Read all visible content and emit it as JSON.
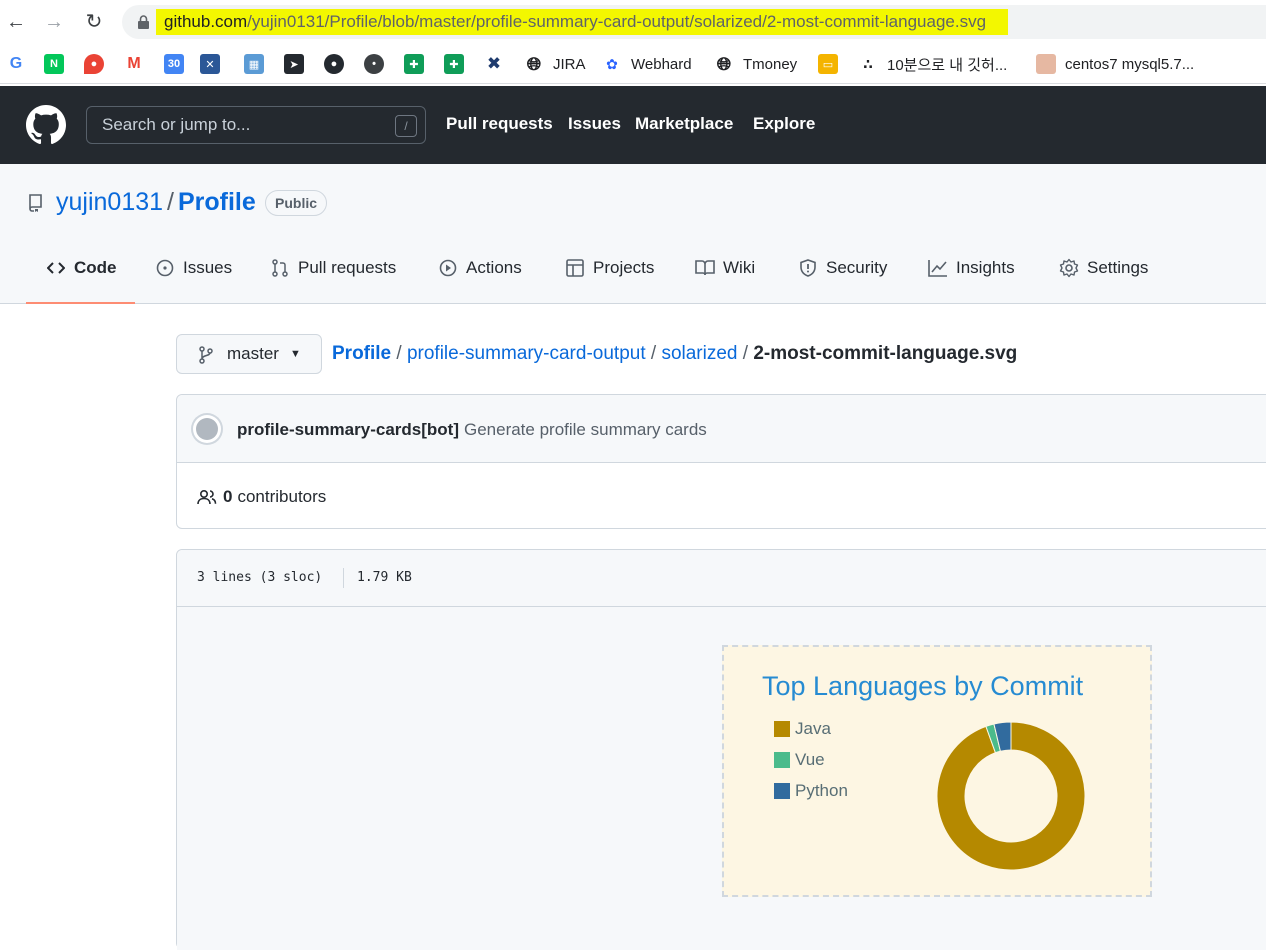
{
  "browser": {
    "url_host": "github.com",
    "url_path": "/yujin0131/Profile/blob/master/profile-summary-card-output/solarized/2-most-commit-language.svg",
    "bookmarks": [
      {
        "label": "",
        "icon": "google-icon"
      },
      {
        "label": "",
        "icon": "naver-icon"
      },
      {
        "label": "",
        "icon": "maps-icon"
      },
      {
        "label": "",
        "icon": "gmail-icon"
      },
      {
        "label": "",
        "icon": "calendar-icon"
      },
      {
        "label": "",
        "icon": "app-icon"
      },
      {
        "label": "",
        "icon": "map-book-icon"
      },
      {
        "label": "",
        "icon": "bird-icon"
      },
      {
        "label": "",
        "icon": "github-icon"
      },
      {
        "label": "",
        "icon": "blob-icon"
      },
      {
        "label": "",
        "icon": "sheets-icon"
      },
      {
        "label": "",
        "icon": "sheets-icon"
      },
      {
        "label": "",
        "icon": "tool-icon"
      },
      {
        "label": "JIRA",
        "icon": "globe-icon"
      },
      {
        "label": "Webhard",
        "icon": "feather-icon"
      },
      {
        "label": "Tmoney",
        "icon": "globe-icon"
      },
      {
        "label": "",
        "icon": "slides-icon"
      },
      {
        "label": "10분으로 내 깃허...",
        "icon": "dots-icon"
      },
      {
        "label": "centos7 mysql5.7...",
        "icon": "face-icon"
      }
    ]
  },
  "header": {
    "search_placeholder": "Search or jump to...",
    "slash_key": "/",
    "nav": [
      "Pull requests",
      "Issues",
      "Marketplace",
      "Explore"
    ]
  },
  "repo": {
    "owner": "yujin0131",
    "separator": "/",
    "name": "Profile",
    "visibility": "Public",
    "tabs": [
      {
        "label": "Code",
        "icon": "code-icon"
      },
      {
        "label": "Issues",
        "icon": "issue-icon"
      },
      {
        "label": "Pull requests",
        "icon": "pull-request-icon"
      },
      {
        "label": "Actions",
        "icon": "play-icon"
      },
      {
        "label": "Projects",
        "icon": "table-icon"
      },
      {
        "label": "Wiki",
        "icon": "book-icon"
      },
      {
        "label": "Security",
        "icon": "shield-icon"
      },
      {
        "label": "Insights",
        "icon": "graph-icon"
      },
      {
        "label": "Settings",
        "icon": "gear-icon"
      }
    ]
  },
  "file": {
    "branch": "master",
    "crumbs": [
      "Profile",
      "profile-summary-card-output",
      "solarized"
    ],
    "crumb_sep": "/",
    "filename": "2-most-commit-language.svg",
    "commit_author": "profile-summary-cards[bot]",
    "commit_message": "Generate profile summary cards",
    "contributors_count": "0",
    "contributors_label": "contributors",
    "lines_info": "3 lines (3 sloc)",
    "size": "1.79 KB"
  },
  "chart_data": {
    "type": "pie",
    "title": "Top Languages by Commit",
    "categories": [
      "Java",
      "Vue",
      "Python"
    ],
    "values": [
      94.5,
      1.8,
      3.7
    ],
    "colors": [
      "#b58900",
      "#4bbb8b",
      "#316b9e"
    ],
    "donut": true,
    "legend_position": "left"
  }
}
